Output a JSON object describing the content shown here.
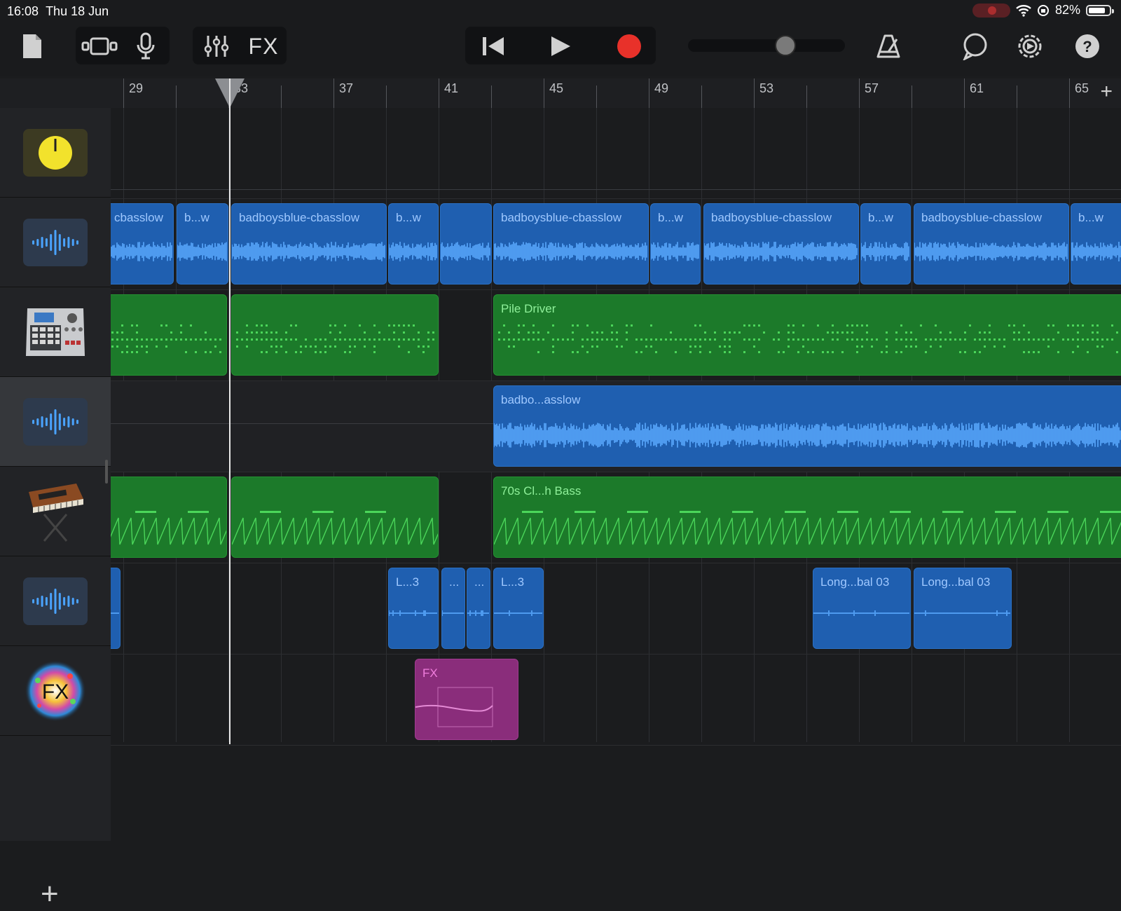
{
  "status": {
    "time": "16:08",
    "date": "Thu 18 Jun",
    "battery": "82%",
    "battery_level": 0.82
  },
  "toolbar": {
    "fx_label": "FX",
    "volume_level": 0.62,
    "icons": [
      "document-icon",
      "view-toggle-icon",
      "microphone-icon",
      "mixer-icon",
      "rewind-icon",
      "play-icon",
      "record-icon",
      "metronome-icon",
      "loop-icon",
      "settings-icon",
      "help-icon"
    ],
    "record_color": "#e8312a"
  },
  "ruler": {
    "bars": [
      "29",
      "33",
      "37",
      "41",
      "45",
      "49",
      "53",
      "57",
      "61",
      "65"
    ]
  },
  "tracks": [
    {
      "name": "tempo-track",
      "icon": "tempo-knob-icon"
    },
    {
      "name": "audio-track-1",
      "icon": "audio-waveform-icon"
    },
    {
      "name": "drum-machine-track",
      "icon": "drum-machine-icon"
    },
    {
      "name": "audio-track-2",
      "icon": "audio-waveform-icon",
      "selected": true
    },
    {
      "name": "synth-bass-track",
      "icon": "synth-keyboard-icon"
    },
    {
      "name": "audio-track-3",
      "icon": "audio-waveform-icon"
    },
    {
      "name": "fx-track",
      "icon": "fx-burst-icon"
    }
  ],
  "regions": {
    "audio1": [
      "cbasslow",
      "b...w",
      "badboysblue-cbasslow",
      "b...w",
      "badboysblue-cbasslow",
      "b...w",
      "badboysblue-cbasslow",
      "b...w",
      "badboysblue-cbasslow",
      "b...w"
    ],
    "drums": [
      "Pile Driver"
    ],
    "audio2": [
      "badbo...asslow"
    ],
    "bass": [
      "70s Cl...h Bass"
    ],
    "audio3": [
      "L...3",
      "...",
      "...",
      "L...3",
      "Long...bal 03",
      "Long...bal 03"
    ],
    "fx": [
      "FX"
    ]
  },
  "colors": {
    "audio_region": "#1f5fb0",
    "midi_region": "#1c7a2a",
    "fx_region": "#8a2d7b"
  }
}
